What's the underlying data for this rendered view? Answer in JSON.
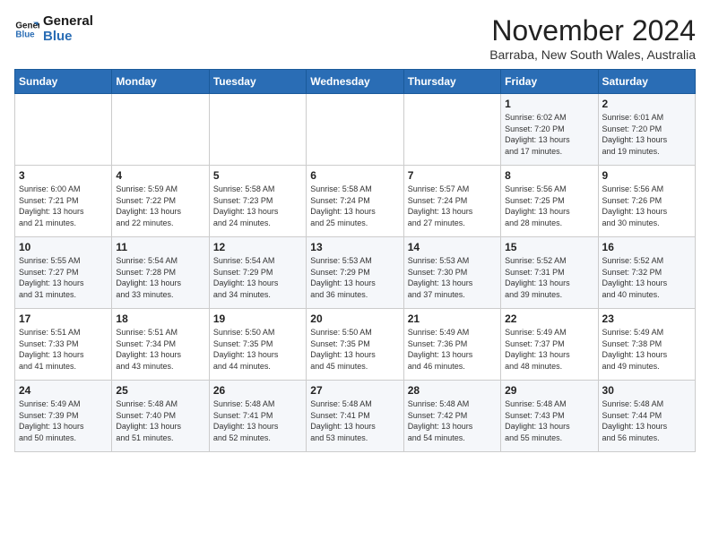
{
  "logo": {
    "line1": "General",
    "line2": "Blue"
  },
  "title": "November 2024",
  "location": "Barraba, New South Wales, Australia",
  "days_header": [
    "Sunday",
    "Monday",
    "Tuesday",
    "Wednesday",
    "Thursday",
    "Friday",
    "Saturday"
  ],
  "weeks": [
    [
      {
        "day": "",
        "info": ""
      },
      {
        "day": "",
        "info": ""
      },
      {
        "day": "",
        "info": ""
      },
      {
        "day": "",
        "info": ""
      },
      {
        "day": "",
        "info": ""
      },
      {
        "day": "1",
        "info": "Sunrise: 6:02 AM\nSunset: 7:20 PM\nDaylight: 13 hours\nand 17 minutes."
      },
      {
        "day": "2",
        "info": "Sunrise: 6:01 AM\nSunset: 7:20 PM\nDaylight: 13 hours\nand 19 minutes."
      }
    ],
    [
      {
        "day": "3",
        "info": "Sunrise: 6:00 AM\nSunset: 7:21 PM\nDaylight: 13 hours\nand 21 minutes."
      },
      {
        "day": "4",
        "info": "Sunrise: 5:59 AM\nSunset: 7:22 PM\nDaylight: 13 hours\nand 22 minutes."
      },
      {
        "day": "5",
        "info": "Sunrise: 5:58 AM\nSunset: 7:23 PM\nDaylight: 13 hours\nand 24 minutes."
      },
      {
        "day": "6",
        "info": "Sunrise: 5:58 AM\nSunset: 7:24 PM\nDaylight: 13 hours\nand 25 minutes."
      },
      {
        "day": "7",
        "info": "Sunrise: 5:57 AM\nSunset: 7:24 PM\nDaylight: 13 hours\nand 27 minutes."
      },
      {
        "day": "8",
        "info": "Sunrise: 5:56 AM\nSunset: 7:25 PM\nDaylight: 13 hours\nand 28 minutes."
      },
      {
        "day": "9",
        "info": "Sunrise: 5:56 AM\nSunset: 7:26 PM\nDaylight: 13 hours\nand 30 minutes."
      }
    ],
    [
      {
        "day": "10",
        "info": "Sunrise: 5:55 AM\nSunset: 7:27 PM\nDaylight: 13 hours\nand 31 minutes."
      },
      {
        "day": "11",
        "info": "Sunrise: 5:54 AM\nSunset: 7:28 PM\nDaylight: 13 hours\nand 33 minutes."
      },
      {
        "day": "12",
        "info": "Sunrise: 5:54 AM\nSunset: 7:29 PM\nDaylight: 13 hours\nand 34 minutes."
      },
      {
        "day": "13",
        "info": "Sunrise: 5:53 AM\nSunset: 7:29 PM\nDaylight: 13 hours\nand 36 minutes."
      },
      {
        "day": "14",
        "info": "Sunrise: 5:53 AM\nSunset: 7:30 PM\nDaylight: 13 hours\nand 37 minutes."
      },
      {
        "day": "15",
        "info": "Sunrise: 5:52 AM\nSunset: 7:31 PM\nDaylight: 13 hours\nand 39 minutes."
      },
      {
        "day": "16",
        "info": "Sunrise: 5:52 AM\nSunset: 7:32 PM\nDaylight: 13 hours\nand 40 minutes."
      }
    ],
    [
      {
        "day": "17",
        "info": "Sunrise: 5:51 AM\nSunset: 7:33 PM\nDaylight: 13 hours\nand 41 minutes."
      },
      {
        "day": "18",
        "info": "Sunrise: 5:51 AM\nSunset: 7:34 PM\nDaylight: 13 hours\nand 43 minutes."
      },
      {
        "day": "19",
        "info": "Sunrise: 5:50 AM\nSunset: 7:35 PM\nDaylight: 13 hours\nand 44 minutes."
      },
      {
        "day": "20",
        "info": "Sunrise: 5:50 AM\nSunset: 7:35 PM\nDaylight: 13 hours\nand 45 minutes."
      },
      {
        "day": "21",
        "info": "Sunrise: 5:49 AM\nSunset: 7:36 PM\nDaylight: 13 hours\nand 46 minutes."
      },
      {
        "day": "22",
        "info": "Sunrise: 5:49 AM\nSunset: 7:37 PM\nDaylight: 13 hours\nand 48 minutes."
      },
      {
        "day": "23",
        "info": "Sunrise: 5:49 AM\nSunset: 7:38 PM\nDaylight: 13 hours\nand 49 minutes."
      }
    ],
    [
      {
        "day": "24",
        "info": "Sunrise: 5:49 AM\nSunset: 7:39 PM\nDaylight: 13 hours\nand 50 minutes."
      },
      {
        "day": "25",
        "info": "Sunrise: 5:48 AM\nSunset: 7:40 PM\nDaylight: 13 hours\nand 51 minutes."
      },
      {
        "day": "26",
        "info": "Sunrise: 5:48 AM\nSunset: 7:41 PM\nDaylight: 13 hours\nand 52 minutes."
      },
      {
        "day": "27",
        "info": "Sunrise: 5:48 AM\nSunset: 7:41 PM\nDaylight: 13 hours\nand 53 minutes."
      },
      {
        "day": "28",
        "info": "Sunrise: 5:48 AM\nSunset: 7:42 PM\nDaylight: 13 hours\nand 54 minutes."
      },
      {
        "day": "29",
        "info": "Sunrise: 5:48 AM\nSunset: 7:43 PM\nDaylight: 13 hours\nand 55 minutes."
      },
      {
        "day": "30",
        "info": "Sunrise: 5:48 AM\nSunset: 7:44 PM\nDaylight: 13 hours\nand 56 minutes."
      }
    ]
  ]
}
